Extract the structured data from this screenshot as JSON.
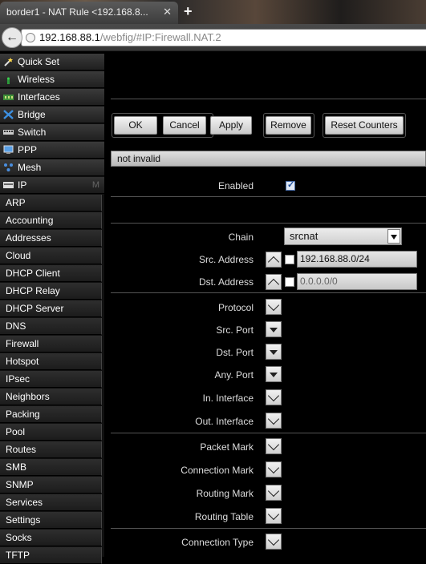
{
  "browser": {
    "tab_title": "border1 - NAT Rule <192.168.8...",
    "tab_close": "✕",
    "new_tab": "+",
    "url_host": "192.168.88.1",
    "url_path": "/webfig/#IP:Firewall.NAT.2"
  },
  "sidebar": {
    "items": [
      {
        "label": "Quick Set",
        "icon": "wand-icon"
      },
      {
        "label": "Wireless",
        "icon": "antenna-icon"
      },
      {
        "label": "Interfaces",
        "icon": "network-card-icon"
      },
      {
        "label": "Bridge",
        "icon": "bridge-icon"
      },
      {
        "label": "Switch",
        "icon": "switch-icon"
      },
      {
        "label": "PPP",
        "icon": "ppp-icon"
      },
      {
        "label": "Mesh",
        "icon": "mesh-icon"
      },
      {
        "label": "IP",
        "icon": "ip-icon",
        "marker": "M"
      }
    ],
    "sub_items": [
      "ARP",
      "Accounting",
      "Addresses",
      "Cloud",
      "DHCP Client",
      "DHCP Relay",
      "DHCP Server",
      "DNS",
      "Firewall",
      "Hotspot",
      "IPsec",
      "Neighbors",
      "Packing",
      "Pool",
      "Routes",
      "SMB",
      "SNMP",
      "Services",
      "Settings",
      "Socks",
      "TFTP"
    ]
  },
  "toolbar": {
    "ok": "OK",
    "cancel": "Cancel",
    "apply": "Apply",
    "remove": "Remove",
    "reset_counters": "Reset Counters"
  },
  "status": "not invalid",
  "form": {
    "enabled_label": "Enabled",
    "enabled": true,
    "chain_label": "Chain",
    "chain_value": "srcnat",
    "src_address_label": "Src. Address",
    "src_address_value": "192.168.88.0/24",
    "dst_address_label": "Dst. Address",
    "dst_address_placeholder": "0.0.0.0/0",
    "protocol_label": "Protocol",
    "src_port_label": "Src. Port",
    "dst_port_label": "Dst. Port",
    "any_port_label": "Any. Port",
    "in_interface_label": "In. Interface",
    "out_interface_label": "Out. Interface",
    "packet_mark_label": "Packet Mark",
    "connection_mark_label": "Connection Mark",
    "routing_mark_label": "Routing Mark",
    "routing_table_label": "Routing Table",
    "connection_type_label": "Connection Type"
  }
}
